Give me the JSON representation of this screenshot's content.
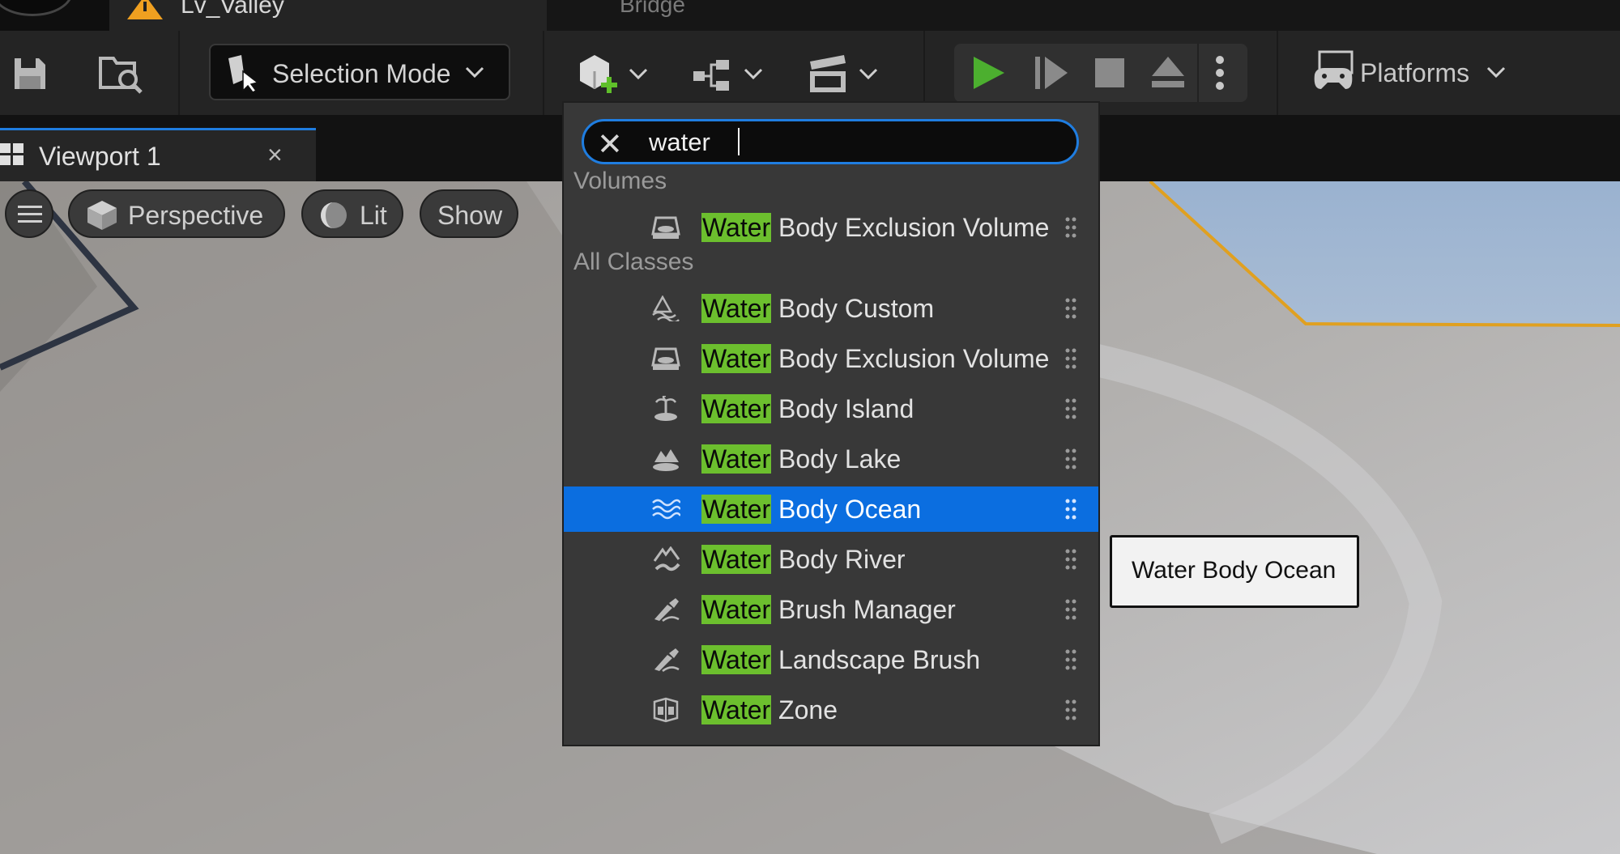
{
  "tabs": {
    "level": "Lv_Valley",
    "bridge": "Bridge"
  },
  "toolbar": {
    "selection_mode": "Selection Mode",
    "platforms": "Platforms"
  },
  "viewport_tab": {
    "label": "Viewport 1",
    "close": "×"
  },
  "viewport": {
    "perspective": "Perspective",
    "lit": "Lit",
    "show": "Show"
  },
  "dropdown": {
    "search_value": "water",
    "highlight": "Water",
    "sections": {
      "volumes": "Volumes",
      "all_classes": "All Classes"
    },
    "volumes_items": [
      {
        "rest": " Body Exclusion Volume",
        "icon": "volume-icon"
      }
    ],
    "all_items": [
      {
        "rest": " Body Custom",
        "icon": "water-custom-icon"
      },
      {
        "rest": " Body Exclusion Volume",
        "icon": "volume-icon"
      },
      {
        "rest": " Body Island",
        "icon": "island-icon"
      },
      {
        "rest": " Body Lake",
        "icon": "lake-icon"
      },
      {
        "rest": " Body Ocean",
        "icon": "ocean-waves-icon",
        "selected": true
      },
      {
        "rest": " Body River",
        "icon": "river-icon"
      },
      {
        "rest": " Brush Manager",
        "icon": "brush-icon"
      },
      {
        "rest": " Landscape Brush",
        "icon": "brush-icon"
      },
      {
        "rest": " Zone",
        "icon": "zone-icon"
      }
    ]
  },
  "tooltip": "Water Body Ocean",
  "colors": {
    "accent": "#1f7de0",
    "selection": "#0b6ee0",
    "match_highlight": "#6cbf2e",
    "play_green": "#4caf2f",
    "selection_outline": "#e0a020",
    "warning": "#f0a020"
  }
}
